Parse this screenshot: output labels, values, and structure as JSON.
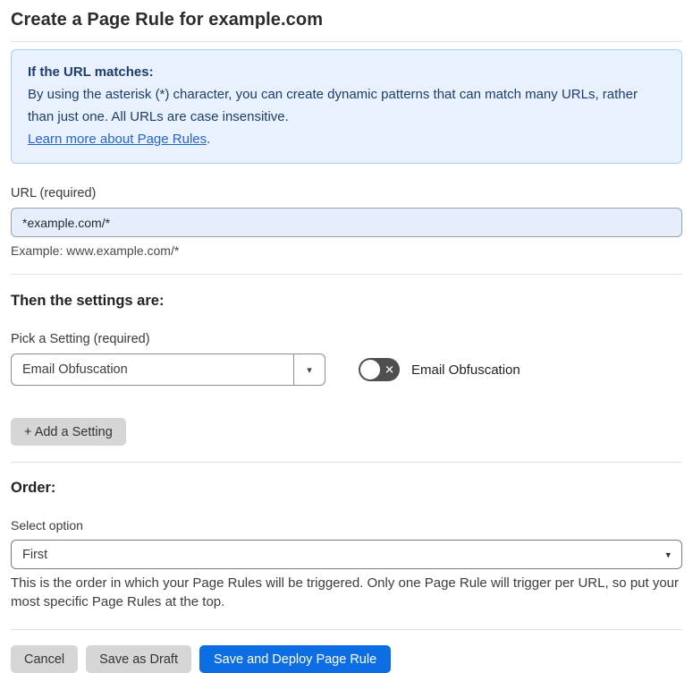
{
  "page": {
    "title": "Create a Page Rule for example.com"
  },
  "info_box": {
    "heading": "If the URL matches:",
    "body": "By using the asterisk (*) character, you can create dynamic patterns that can match many URLs, rather than just one. All URLs are case insensitive.",
    "link_label": "Learn more about Page Rules",
    "link_suffix": "."
  },
  "url_field": {
    "label": "URL (required)",
    "value": "*example.com/*",
    "helper": "Example: www.example.com/*"
  },
  "settings_section": {
    "heading": "Then the settings are:",
    "picker_label": "Pick a Setting (required)",
    "picker_value": "Email Obfuscation",
    "toggle_label": "Email Obfuscation",
    "toggle_state": "off",
    "add_button_label": "+ Add a Setting"
  },
  "order_section": {
    "heading": "Order:",
    "select_label": "Select option",
    "select_value": "First",
    "helper": "This is the order in which your Page Rules will be triggered. Only one Page Rule will trigger per URL, so put your most specific Page Rules at the top."
  },
  "footer": {
    "cancel_label": "Cancel",
    "save_draft_label": "Save as Draft",
    "save_deploy_label": "Save and Deploy Page Rule"
  },
  "icons": {
    "chevron_down": "▾",
    "toggle_off_x": "✕"
  },
  "colors": {
    "info_bg": "#e9f2fc",
    "info_border": "#abcdf2",
    "info_text": "#1d3d6e",
    "link_blue": "#2463d1",
    "input_bg": "#e7eefb",
    "toggle_off_bg": "#4f4f4f",
    "gray_button_bg": "#d6d6d6",
    "primary_button_bg": "#0d6ee4"
  }
}
